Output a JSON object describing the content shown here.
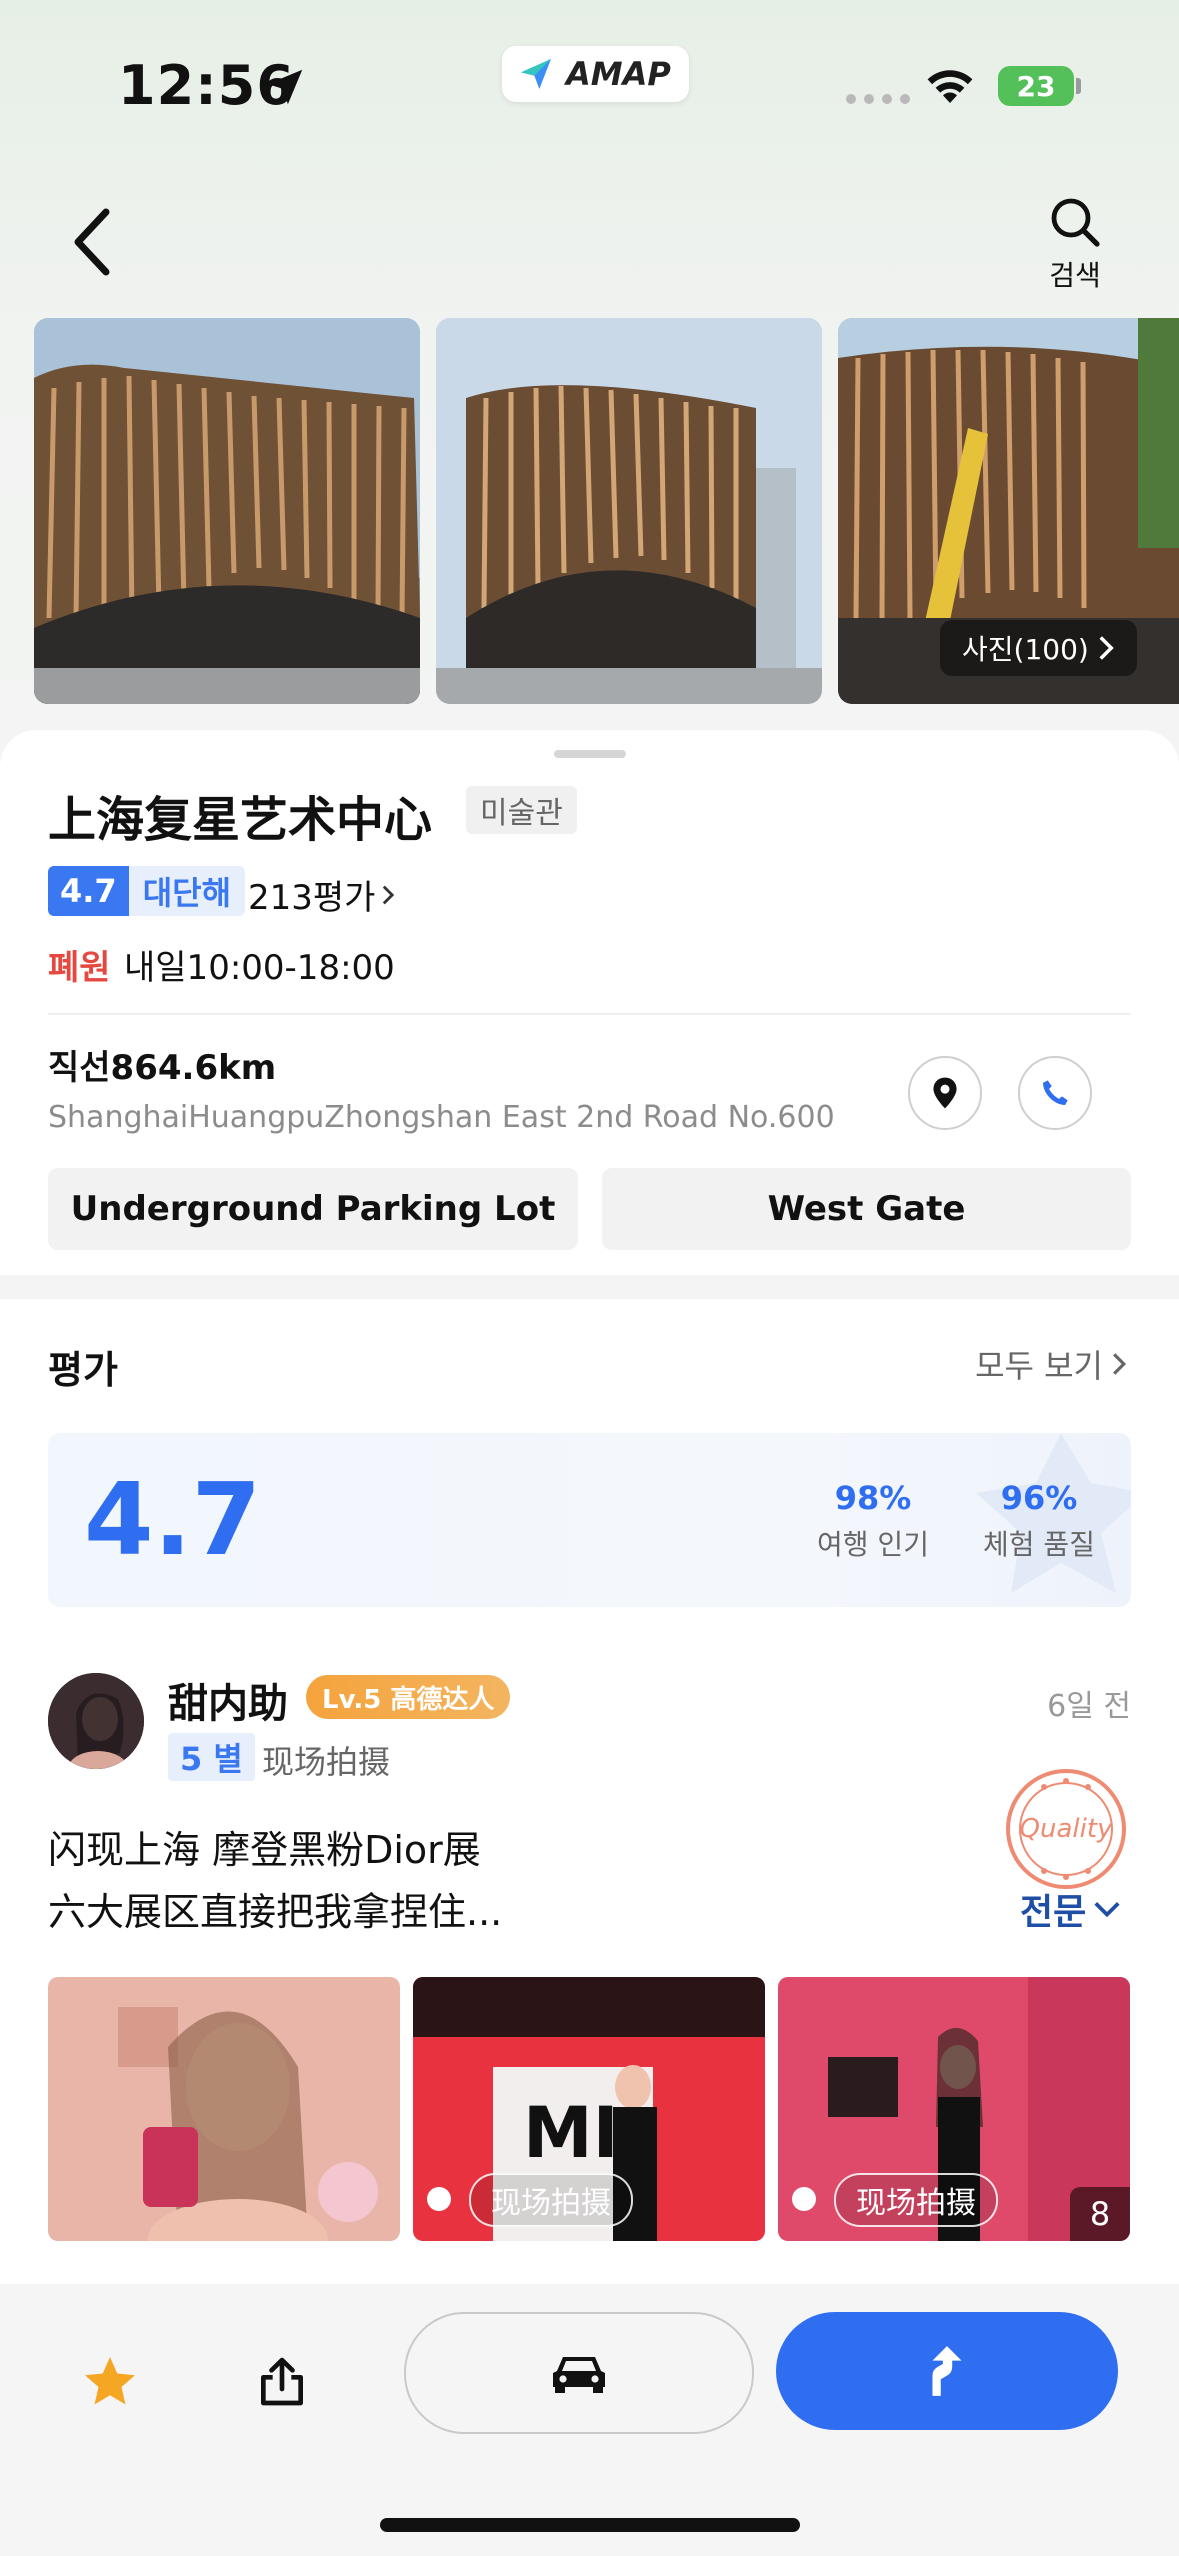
{
  "status_bar": {
    "time": "12:56",
    "app_pill": "AMAP",
    "battery": "23"
  },
  "header": {
    "search_label": "검색"
  },
  "gallery": {
    "photo_count": "사진(100)"
  },
  "poi": {
    "name": "上海复星艺术中心",
    "category": "미술관",
    "rating": "4.7",
    "rating_word": "대단해",
    "review_count": "213평가",
    "hours_status": "폐원",
    "hours": "내일10:00-18:00",
    "distance": "직선864.6km",
    "address": "ShanghaiHuangpuZhongshan East 2nd Road No.600",
    "gates": [
      "Underground Parking Lot",
      "West Gate"
    ]
  },
  "reviews": {
    "title": "평가",
    "see_all": "모두 보기",
    "score": "4.7",
    "metrics": [
      {
        "value": "98%",
        "label": "여행 인기"
      },
      {
        "value": "96%",
        "label": "체험 품질"
      }
    ],
    "item": {
      "user": "甜内助",
      "level": "Lv.5 高德达人",
      "time_ago": "6일 전",
      "stars": "5 별",
      "tag": "现场拍摄",
      "text_line1": "闪现上海 摩登黑粉Dior展",
      "text_line2": "六大展区直接把我拿捏住...",
      "stamp": "Quality",
      "full_text": "전문",
      "photo_chip": "现场拍摄",
      "more_photos": "8"
    }
  },
  "colors": {
    "accent": "#2f6ef0",
    "closed": "#e5483f",
    "level_badge": "#f5a33c"
  }
}
